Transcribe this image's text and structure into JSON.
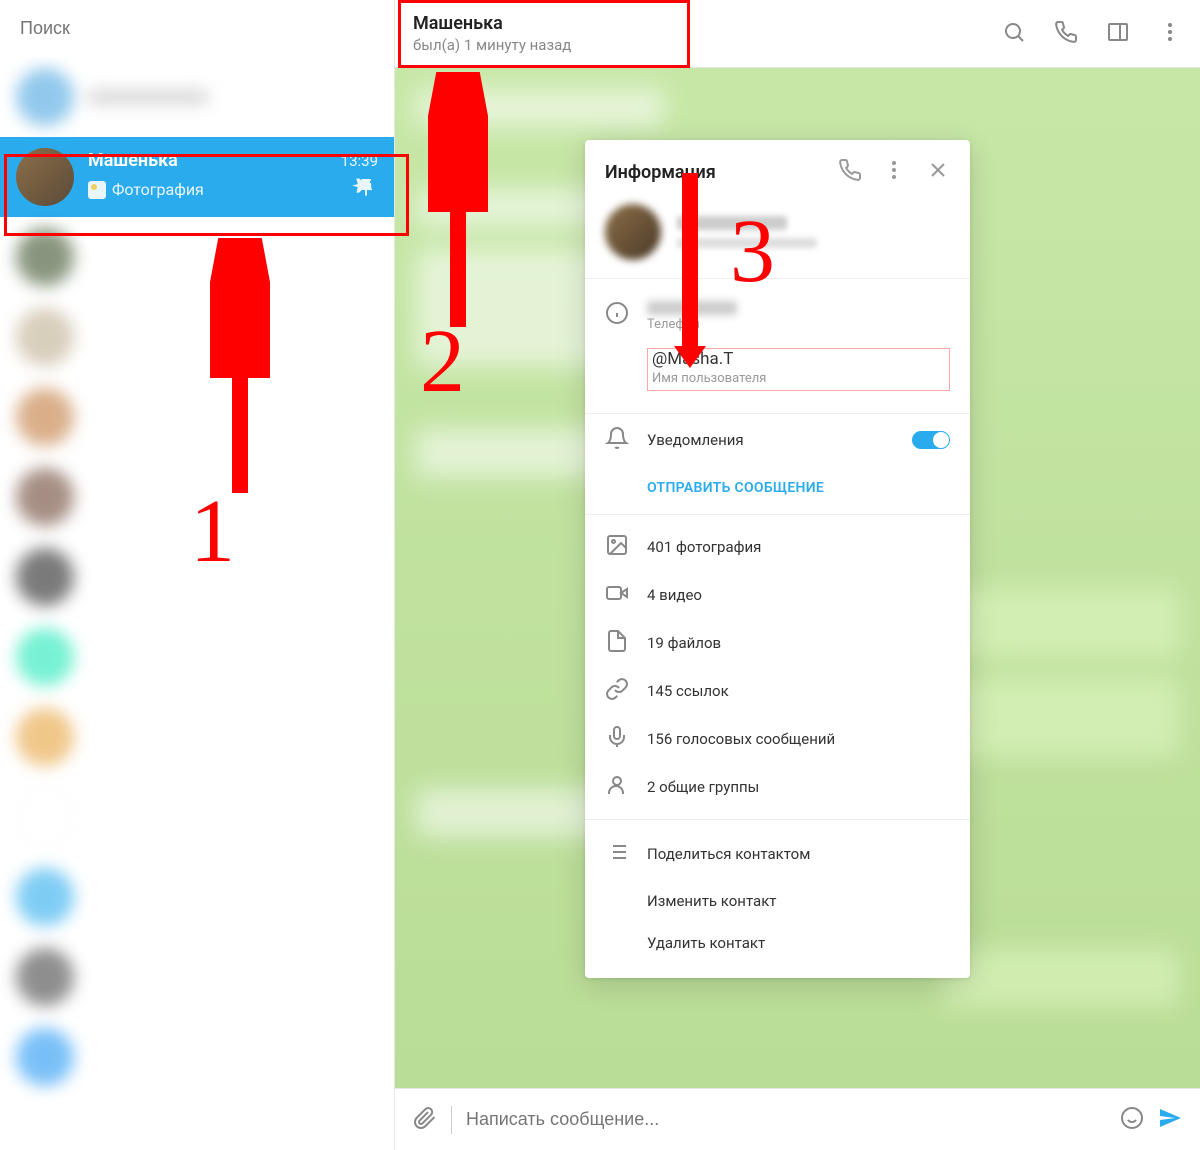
{
  "search": {
    "placeholder": "Поиск"
  },
  "active_chat": {
    "name": "Машенька",
    "time": "13:39",
    "preview": "Фотография"
  },
  "header": {
    "name": "Машенька",
    "status": "был(а) 1 минуту назад"
  },
  "info": {
    "title": "Информация",
    "phone_label": "Телефон",
    "username_value": "@Masha.T",
    "username_label": "Имя пользователя",
    "notifications_label": "Уведомления",
    "send_message": "ОТПРАВИТЬ СООБЩЕНИЕ",
    "media": {
      "photos": "401 фотография",
      "videos": "4 видео",
      "files": "19 файлов",
      "links": "145 ссылок",
      "voice": "156 голосовых сообщений",
      "groups": "2 общие группы"
    },
    "actions": {
      "share": "Поделиться контактом",
      "edit": "Изменить контакт",
      "delete": "Удалить контакт"
    }
  },
  "composer": {
    "placeholder": "Написать сообщение..."
  },
  "annotations": {
    "n1": "1",
    "n2": "2",
    "n3": "3"
  }
}
